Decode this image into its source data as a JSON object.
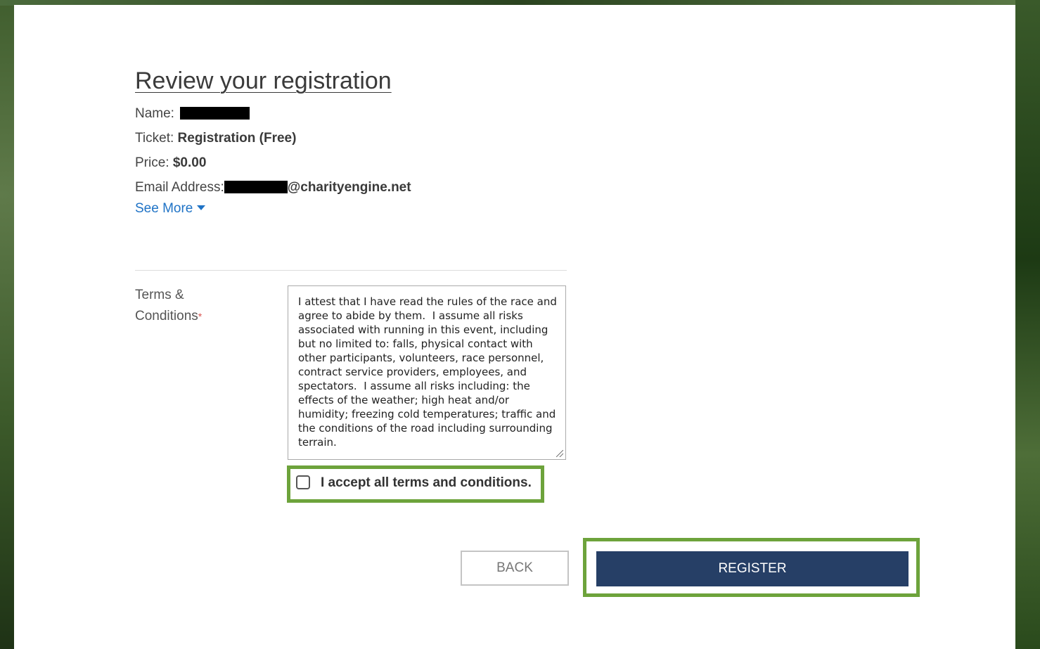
{
  "review": {
    "title": "Review your registration",
    "name_label": "Name:",
    "ticket_label": "Ticket:",
    "ticket_value": "Registration (Free)",
    "price_label": "Price:",
    "price_value": "$0.00",
    "email_label": "Email Address:",
    "email_value": "@charityengine.net",
    "see_more": "See More"
  },
  "terms": {
    "label_line1": "Terms &",
    "label_line2": "Conditions",
    "required_mark": "*",
    "text": "I attest that I have read the rules of the race and agree to abide by them.  I assume all risks associated with running in this event, including but no limited to: falls, physical contact with other participants, volunteers, race personnel, contract service providers, employees, and spectators.  I assume all risks including: the effects of the weather; high heat and/or humidity; freezing cold temperatures; traffic and the conditions of the road including surrounding terrain.",
    "accept_label": "I accept all terms and conditions.",
    "accepted": false
  },
  "actions": {
    "back_label": "BACK",
    "register_label": "REGISTER"
  },
  "colors": {
    "highlight": "#6da33b",
    "register_bg": "#263f66",
    "link": "#1f73c6",
    "required": "#d9534f"
  }
}
